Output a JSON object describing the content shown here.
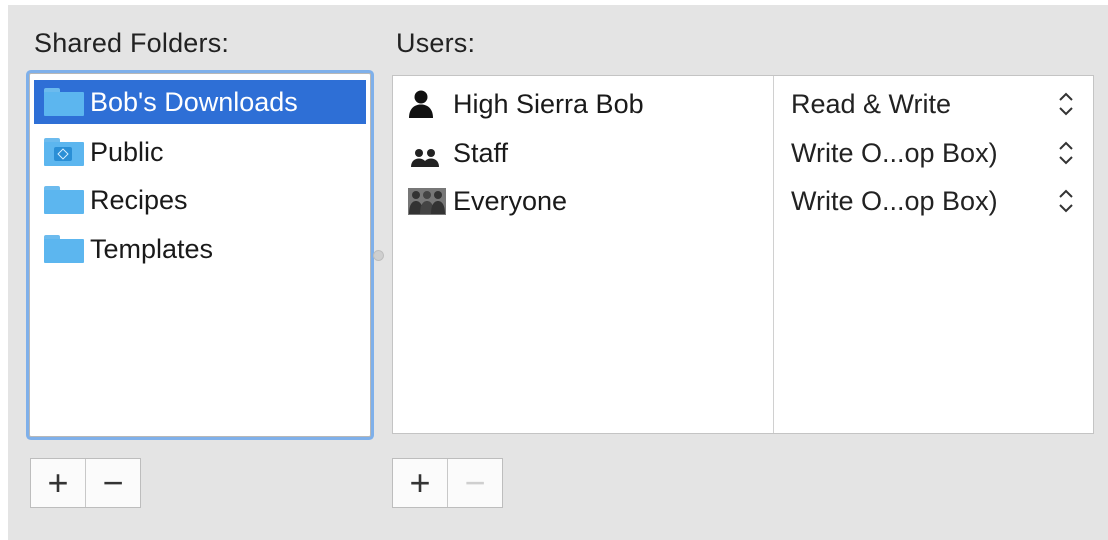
{
  "shared_folders": {
    "heading": "Shared Folders:",
    "items": [
      {
        "label": "Bob's Downloads",
        "icon": "folder-icon",
        "selected": true
      },
      {
        "label": "Public",
        "icon": "public-folder-icon",
        "selected": false
      },
      {
        "label": "Recipes",
        "icon": "folder-icon",
        "selected": false
      },
      {
        "label": "Templates",
        "icon": "folder-icon",
        "selected": false
      }
    ],
    "add_label": "+",
    "remove_label": "−"
  },
  "users": {
    "heading": "Users:",
    "rows": [
      {
        "name": "High Sierra Bob",
        "icon": "single-user-icon",
        "permission": "Read & Write"
      },
      {
        "name": "Staff",
        "icon": "group-icon",
        "permission": "Write O...op Box)"
      },
      {
        "name": "Everyone",
        "icon": "everyone-icon",
        "permission": "Write O...op Box)"
      }
    ],
    "add_label": "+",
    "remove_label": "−"
  },
  "colors": {
    "selection": "#2e6fd6",
    "focus_ring": "#7fb0ea",
    "folder": "#5cb6ef",
    "panel_bg": "#e4e4e4"
  }
}
